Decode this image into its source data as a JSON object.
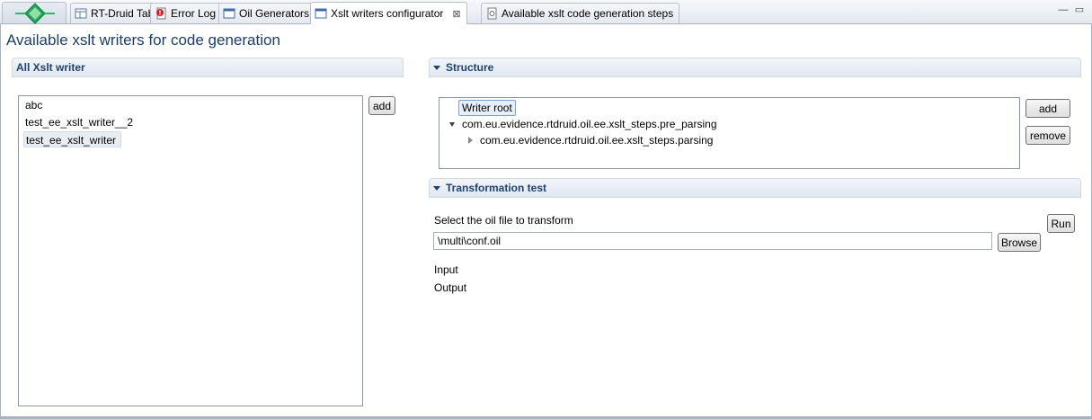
{
  "tabs": [
    {
      "label": "RT-Druid Table",
      "icon": "table-icon"
    },
    {
      "label": "Error Log",
      "icon": "error-log-icon"
    },
    {
      "label": "Oil Generators",
      "icon": "window-icon"
    },
    {
      "label": "Xslt writers configurator",
      "icon": "window-icon",
      "active": true
    },
    {
      "label": "Available xslt code generation steps",
      "icon": "page-icon"
    }
  ],
  "page_title": "Available xslt writers for code generation",
  "writers_section": {
    "title": "All Xslt writer",
    "items": [
      "abc",
      "test_ee_xslt_writer__2",
      "test_ee_xslt_writer"
    ],
    "selected_index": 2,
    "add_label": "add"
  },
  "structure_section": {
    "title": "Structure",
    "tree": {
      "root": "Writer root",
      "child": "com.eu.evidence.rtdruid.oil.ee.xslt_steps.pre_parsing",
      "grandchild": "com.eu.evidence.rtdruid.oil.ee.xslt_steps.parsing"
    },
    "add_label": "add",
    "remove_label": "remove"
  },
  "transform_section": {
    "title": "Transformation test",
    "select_label": "Select the oil file to transform",
    "file_value": "\\multi\\conf.oil",
    "browse_label": "Browse",
    "run_label": "Run",
    "input_label": "Input",
    "output_label": "Output"
  },
  "colors": {
    "accent": "#1d4272",
    "title": "#1a3e6e",
    "selection": "#e6eefa"
  }
}
